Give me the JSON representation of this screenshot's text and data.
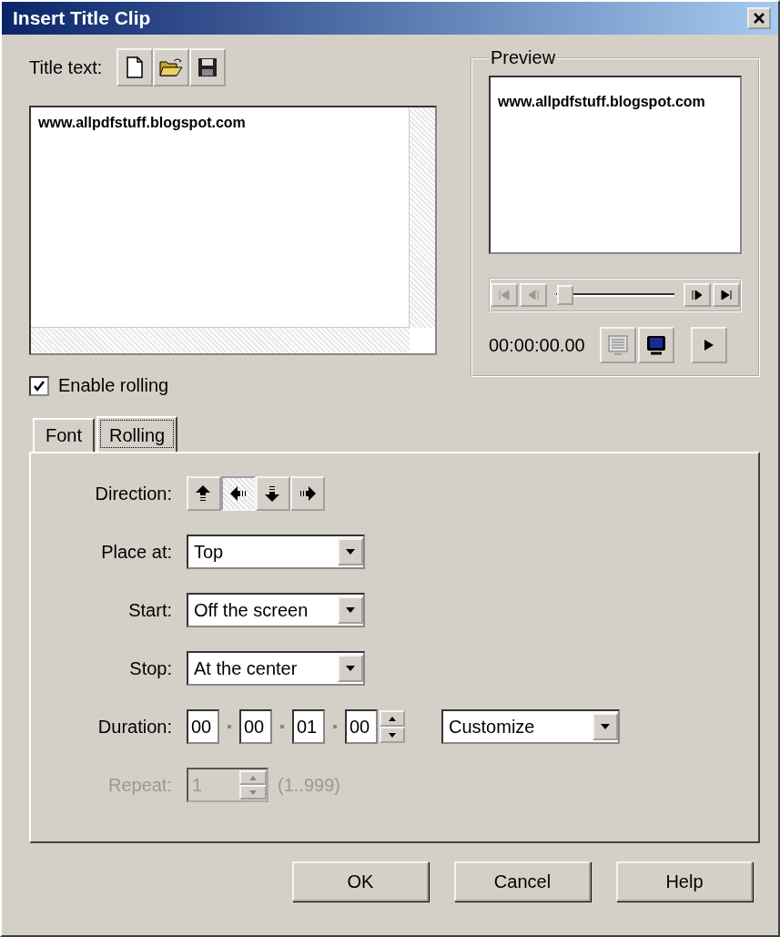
{
  "window": {
    "title": "Insert Title Clip"
  },
  "title_text": {
    "label": "Title text:",
    "text": "www.allpdfstuff.blogspot.com"
  },
  "enable_rolling": {
    "label": "Enable rolling",
    "checked": true
  },
  "preview": {
    "label": "Preview",
    "text": "www.allpdfstuff.blogspot.com",
    "level": 0.0,
    "time": "00:00:00.00"
  },
  "tabs": [
    {
      "label": "Font",
      "selected": false
    },
    {
      "label": "Rolling",
      "selected": true
    }
  ],
  "rolling": {
    "direction_label": "Direction:",
    "directions": [
      {
        "kind": "up",
        "selected": false
      },
      {
        "kind": "left",
        "selected": true
      },
      {
        "kind": "down",
        "selected": false
      },
      {
        "kind": "right",
        "selected": false
      }
    ],
    "fields": [
      {
        "label": "Place at:",
        "value": "Top"
      },
      {
        "label": "Start:",
        "value": "Off the screen"
      },
      {
        "label": "Stop:",
        "value": "At the center"
      }
    ],
    "duration": {
      "label": "Duration:",
      "parts": [
        "00",
        "00",
        "01",
        "00"
      ],
      "preset": "Customize"
    },
    "repeat": {
      "label": "Repeat:",
      "value": "1",
      "range": "(1..999)",
      "disabled": true
    }
  },
  "buttons": [
    {
      "label": "OK"
    },
    {
      "label": "Cancel"
    },
    {
      "label": "Help"
    }
  ]
}
